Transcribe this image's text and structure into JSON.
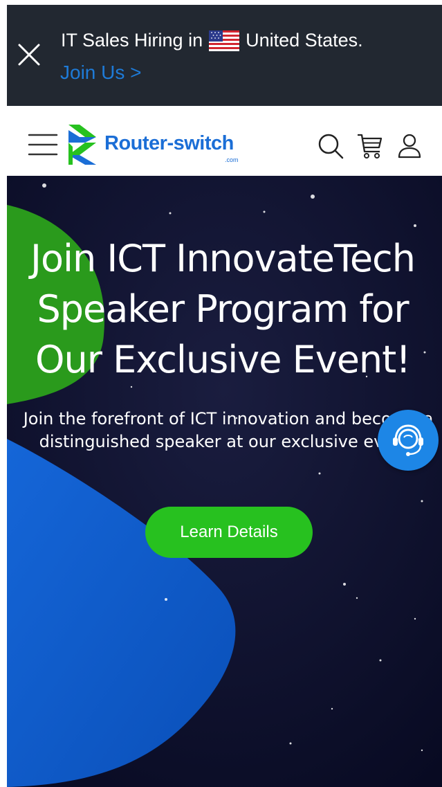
{
  "banner": {
    "text_before_flag": "IT Sales Hiring in",
    "text_after_flag": "United States.",
    "link_text": "Join Us >",
    "flag_icon": "us-flag-icon",
    "close_icon": "close-icon",
    "background": "#222831",
    "link_color": "#1e7bd8"
  },
  "header": {
    "logo_text": "Router-switch",
    "logo_sub": ".com",
    "brand_color": "#1b6ed6",
    "icons": [
      "hamburger-menu-icon",
      "search-icon",
      "cart-icon",
      "user-icon"
    ]
  },
  "hero": {
    "title": "Join ICT InnovateTech Speaker Program for Our Exclusive Event!",
    "description": "Join the forefront of ICT innovation and become a distinguished speaker at our exclusive event!",
    "cta_label": "Learn Details",
    "cta_color": "#27c11f",
    "background": "#0b0d2b"
  },
  "support_widget": {
    "icon": "headset-support-icon",
    "color": "#1d86e6"
  }
}
